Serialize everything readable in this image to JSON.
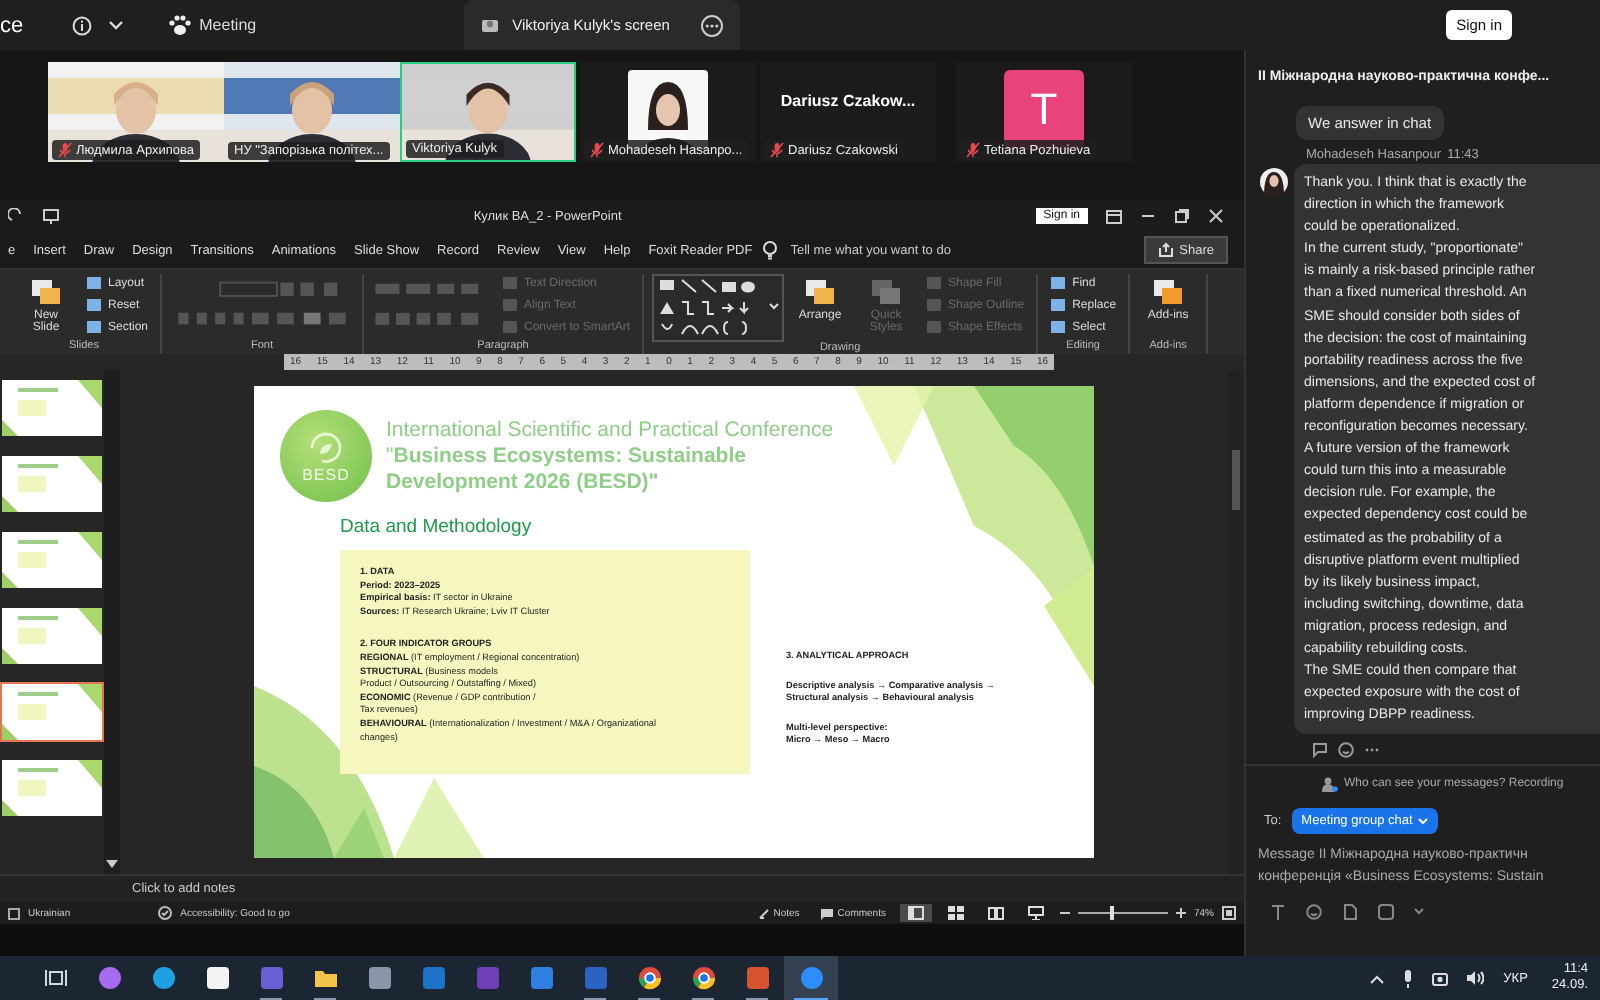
{
  "zoom_bar": {
    "left_text": "ce",
    "meeting_label": "Meeting",
    "share_tab": "Viktoriya Kulyk's screen",
    "sign_in": "Sign in"
  },
  "participants": [
    {
      "name": "Людмила Архипова",
      "kind": "video",
      "muted": true,
      "selected": false
    },
    {
      "name": "НУ \"Запорізька політех...",
      "kind": "video",
      "muted": false,
      "selected": false
    },
    {
      "name": "Viktoriya Kulyk",
      "kind": "video",
      "muted": false,
      "selected": true
    },
    {
      "name": "Mohadeseh Hasanpo...",
      "muted": true,
      "selected": false
    },
    {
      "name": "Dariusz Czakowski",
      "kind": "name",
      "display": "Dariusz  Czakow...",
      "muted": true,
      "selected": false
    },
    {
      "name": "Tetiana Pozhuieva",
      "kind": "initial",
      "initial": "T",
      "color": "#e8437a",
      "muted": true,
      "selected": false
    }
  ],
  "powerpoint": {
    "title": "Кулик BA_2  -  PowerPoint",
    "sign_in": "Sign in",
    "tabs": [
      {
        "label": "e",
        "selected": false
      },
      {
        "label": "Insert",
        "selected": false
      },
      {
        "label": "Draw",
        "selected": false
      },
      {
        "label": "Design",
        "selected": false
      },
      {
        "label": "Transitions",
        "selected": false
      },
      {
        "label": "Animations",
        "selected": false
      },
      {
        "label": "Slide Show",
        "selected": false
      },
      {
        "label": "Record",
        "selected": false
      },
      {
        "label": "Review",
        "selected": false
      },
      {
        "label": "View",
        "selected": false
      },
      {
        "label": "Help",
        "selected": false
      },
      {
        "label": "Foxit Reader PDF",
        "selected": false
      }
    ],
    "tell_me": "Tell me what you want to do",
    "share": "Share",
    "ribbon": [
      {
        "label": "Slides",
        "kind": "slides",
        "buttons": [
          {
            "label": "New Slide",
            "kind": "large",
            "disabled": false
          },
          {
            "label": "Layout",
            "kind": "small",
            "disabled": false
          },
          {
            "label": "Reset",
            "kind": "small",
            "disabled": false
          },
          {
            "label": "Section",
            "kind": "small",
            "disabled": false
          }
        ]
      },
      {
        "label": "Font",
        "kind": "font"
      },
      {
        "label": "Paragraph",
        "kind": "paragraph",
        "buttons": [
          {
            "label": "Text Direction",
            "kind": "small",
            "disabled": true
          },
          {
            "label": "Align Text",
            "kind": "small",
            "disabled": true
          },
          {
            "label": "Convert to SmartArt",
            "kind": "small",
            "disabled": true
          }
        ]
      },
      {
        "label": "Drawing",
        "kind": "drawing",
        "buttons": [
          {
            "label": "Arrange",
            "kind": "large",
            "disabled": false
          },
          {
            "label": "Quick Styles",
            "kind": "large",
            "disabled": true
          },
          {
            "label": "Shape Fill",
            "kind": "small",
            "disabled": true
          },
          {
            "label": "Shape Outline",
            "kind": "small",
            "disabled": true
          },
          {
            "label": "Shape Effects",
            "kind": "small",
            "disabled": true
          }
        ]
      },
      {
        "label": "Editing",
        "kind": "editing",
        "buttons": [
          {
            "label": "Find",
            "kind": "small",
            "disabled": false
          },
          {
            "label": "Replace",
            "kind": "small",
            "disabled": false
          },
          {
            "label": "Select",
            "kind": "small",
            "disabled": false
          }
        ]
      },
      {
        "label": "Add-ins",
        "kind": "addins",
        "buttons": [
          {
            "label": "Add-ins",
            "kind": "large",
            "disabled": false
          }
        ]
      }
    ],
    "ruler": [
      "16",
      "15",
      "14",
      "13",
      "12",
      "11",
      "10",
      "9",
      "8",
      "7",
      "6",
      "5",
      "4",
      "3",
      "2",
      "1",
      "0",
      "1",
      "2",
      "3",
      "4",
      "5",
      "6",
      "7",
      "8",
      "9",
      "10",
      "11",
      "12",
      "13",
      "14",
      "15",
      "16"
    ],
    "thumbnails": [
      {
        "selected": false
      },
      {
        "selected": false
      },
      {
        "selected": false
      },
      {
        "selected": false
      },
      {
        "selected": true
      },
      {
        "selected": false
      }
    ],
    "slide": {
      "logo": "BESD",
      "title": "International Scientific and Practical Conference \"**Business Ecosystems: Sustainable Development 2026 (BESD)\"**",
      "heading": "Data and Methodology",
      "box": [
        {
          "heading": "1. DATA",
          "lines": [
            "**Period: 2023–2025**",
            "**Empirical basis:** IT sector in Ukraine",
            "**Sources:** IT Research Ukraine; Lviv IT Cluster"
          ]
        },
        {
          "heading": "2. FOUR INDICATOR GROUPS",
          "lines": [
            "**REGIONAL** (IT employment / Regional concentration)",
            "**STRUCTURAL** (Business models",
            "Product / Outsourcing / Outstaffing / Mixed)",
            "**ECONOMIC** (Revenue / GDP contribution /",
            "Tax revenues)",
            "**BEHAVIOURAL** (Internationalization / Investment / M&A / Organizational",
            "changes)"
          ]
        }
      ],
      "approach": [
        {
          "heading": "3. ANALYTICAL APPROACH"
        },
        {
          "lines": [
            "Descriptive analysis → Comparative analysis →",
            "Structural analysis → Behavioural analysis"
          ]
        },
        {
          "lines": [
            "Multi-level perspective:",
            "Micro → Meso → Macro"
          ]
        }
      ]
    },
    "notes_placeholder": "Click to add notes",
    "status": {
      "language": "Ukrainian",
      "accessibility": "Accessibility: Good to go",
      "notes": "Notes",
      "comments": "Comments",
      "views": [
        {
          "kind": "normal",
          "selected": true
        },
        {
          "kind": "sorter",
          "selected": false
        },
        {
          "kind": "reading",
          "selected": false
        },
        {
          "kind": "show",
          "selected": false
        }
      ],
      "zoom_slider": {
        "level": 0.35
      },
      "zoom": "74%"
    }
  },
  "chat": {
    "title": "II Міжнародна науково-практична конфе...",
    "messages": [
      {
        "kind": "own",
        "text": "We answer in chat"
      },
      {
        "kind": "incoming",
        "sender": "Mohadeseh Hasanpour",
        "time": "11:43",
        "lines": [
          "Thank you. I think that is exactly the",
          "direction in which the framework",
          "could be operationalized.",
          "In the current study, \"proportionate\"",
          "is mainly a risk-based principle rather",
          "than a fixed numerical threshold. An",
          "SME should consider both sides of",
          "the decision: the cost of maintaining",
          "portability readiness across the five",
          "dimensions, and the expected cost of",
          "platform dependence if migration or",
          "reconfiguration becomes necessary.",
          "A future version of the framework",
          "could turn this into a measurable",
          "decision rule. For example, the",
          "expected dependency cost could be",
          "estimated as the probability of a",
          "disruptive platform event multiplied",
          "by its likely business impact,",
          "including switching, downtime, data",
          "migration, process redesign, and",
          "capability rebuilding costs.",
          "The SME could then compare that",
          "expected exposure with the cost of",
          "improving DBPP readiness."
        ]
      }
    ],
    "notice": "Who can see your messages? Recording",
    "to_label": "To:",
    "recipient": "Meeting group chat",
    "placeholder": "Message II Міжнародна науково-практичн\nконференція «Business Ecosystems: Sustain"
  },
  "taskbar": {
    "apps": [
      {
        "kind": "taskview",
        "open": false,
        "selected": false
      },
      {
        "kind": "copilot",
        "open": false,
        "selected": false
      },
      {
        "kind": "edge",
        "open": false,
        "selected": false
      },
      {
        "kind": "store",
        "open": false,
        "selected": false
      },
      {
        "kind": "save",
        "open": true,
        "selected": false
      },
      {
        "kind": "folder",
        "open": true,
        "selected": false
      },
      {
        "kind": "calculator",
        "open": false,
        "selected": false
      },
      {
        "kind": "mail",
        "open": false,
        "selected": false
      },
      {
        "kind": "yahoo",
        "open": false,
        "selected": false
      },
      {
        "kind": "scanner",
        "open": false,
        "selected": false
      },
      {
        "kind": "word",
        "open": true,
        "selected": false
      },
      {
        "kind": "chrome",
        "open": true,
        "selected": false
      },
      {
        "kind": "chrome",
        "open": true,
        "selected": false
      },
      {
        "kind": "powerpoint",
        "open": true,
        "selected": false
      },
      {
        "kind": "zoom",
        "open": true,
        "selected": true
      }
    ],
    "language": "УКР",
    "time": "11:4",
    "date": "24.09."
  }
}
